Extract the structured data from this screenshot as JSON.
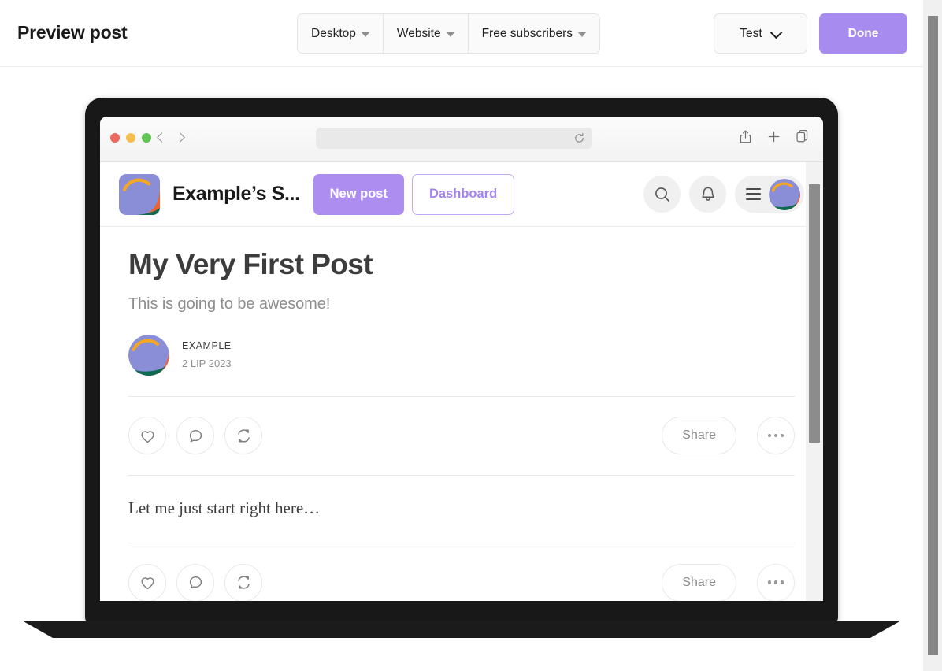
{
  "toolbar": {
    "page_title": "Preview post",
    "segments": [
      {
        "label": "Desktop",
        "icon": "chevron-down-icon"
      },
      {
        "label": "Website",
        "icon": "chevron-down-icon"
      },
      {
        "label": "Free subscribers",
        "icon": "chevron-down-icon"
      }
    ],
    "test_label": "Test",
    "done_label": "Done",
    "done_color": "#a88bee"
  },
  "browser": {
    "traffic_lights": [
      "#ed6a5e",
      "#f4bf4f",
      "#61c554"
    ],
    "back_icon": "chevron-left-icon",
    "forward_icon": "chevron-right-icon",
    "url_value": "",
    "url_placeholder": "",
    "reload_icon": "reload-icon",
    "share_icon": "share-icon",
    "new_tab_icon": "plus-icon",
    "tabs_icon": "tabs-overview-icon"
  },
  "site": {
    "brand_name": "Example’s S...",
    "logo_icon": "brand-logo-icon",
    "new_post_label": "New post",
    "new_post_color": "#ad8ef0",
    "dashboard_label": "Dashboard",
    "dashboard_color": "#a384ec",
    "search_icon": "search-icon",
    "bell_icon": "bell-icon",
    "menu_icon": "hamburger-menu-icon",
    "avatar_icon": "user-avatar-icon"
  },
  "post": {
    "title": "My Very First Post",
    "subtitle": "This is going to be awesome!",
    "author": "EXAMPLE",
    "date": "2 LIP 2023",
    "body": "Let me just start right here…",
    "actions": {
      "like_icon": "heart-icon",
      "comment_icon": "comment-bubble-icon",
      "restack_icon": "restack-refresh-icon",
      "share_label": "Share",
      "more_icon": "more-options-icon"
    }
  }
}
